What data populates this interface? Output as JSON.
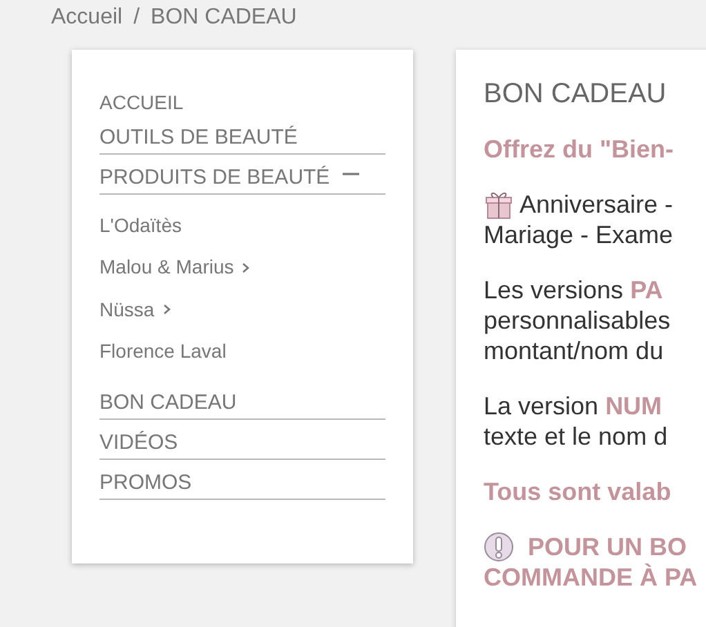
{
  "breadcrumb": {
    "separator": "/",
    "items": [
      {
        "label": "Accueil"
      },
      {
        "label": "BON CADEAU"
      }
    ]
  },
  "sidebar": {
    "items": [
      {
        "label": "ACCUEIL",
        "kind": "plain"
      },
      {
        "label": "OUTILS DE BEAUTÉ",
        "kind": "section"
      },
      {
        "label": "PRODUITS DE BEAUTÉ",
        "kind": "section",
        "expanded": true,
        "children": [
          {
            "label": "L'Odaïtès",
            "expandable": false
          },
          {
            "label": "Malou & Marius",
            "expandable": true
          },
          {
            "label": "Nüssa",
            "expandable": true
          },
          {
            "label": "Florence Laval",
            "expandable": false
          }
        ]
      },
      {
        "label": "BON CADEAU",
        "kind": "section"
      },
      {
        "label": "VIDÉOS",
        "kind": "section"
      },
      {
        "label": "PROMOS",
        "kind": "section"
      }
    ]
  },
  "main": {
    "title": "BON CADEAU",
    "blocks": [
      {
        "kind": "heading",
        "lines": [
          "Offrez du \"Bien-"
        ]
      },
      {
        "kind": "occasion",
        "lines": [
          "Anniversaire -",
          "Mariage - Exame"
        ]
      },
      {
        "kind": "text",
        "lines": [
          "Les versions **PA**",
          "personnalisables",
          "montant/nom du"
        ]
      },
      {
        "kind": "text",
        "lines": [
          "La version **NUM**",
          "texte et le nom d"
        ]
      },
      {
        "kind": "heading",
        "lines": [
          "Tous sont valab"
        ]
      },
      {
        "kind": "alert",
        "lines": [
          "POUR UN BO",
          "COMMANDE À PA"
        ]
      }
    ]
  }
}
